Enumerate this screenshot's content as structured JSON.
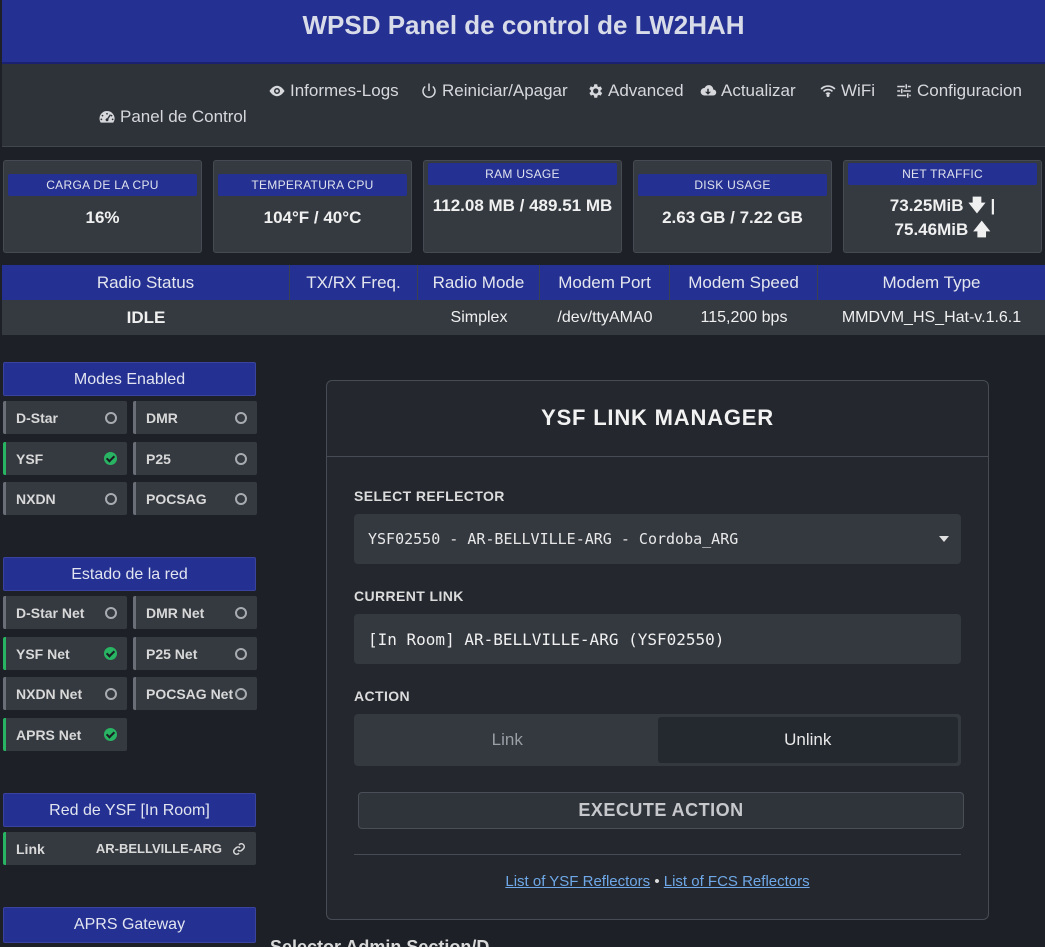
{
  "header": {
    "title": "WPSD Panel de control de LW2HAH"
  },
  "nav": {
    "items": [
      {
        "label": "Informes-Logs",
        "icon": "eye-icon"
      },
      {
        "label": "Reiniciar/Apagar",
        "icon": "power-icon"
      },
      {
        "label": "Advanced",
        "icon": "gear-icon"
      },
      {
        "label": "Actualizar",
        "icon": "cloud-download-icon"
      },
      {
        "label": "WiFi",
        "icon": "wifi-icon"
      },
      {
        "label": "Configuracion",
        "icon": "sliders-icon"
      }
    ],
    "dashboard": {
      "label": "Panel de Control",
      "icon": "gauge-icon"
    }
  },
  "stats": [
    {
      "label": "CARGA DE LA CPU",
      "value": "16%"
    },
    {
      "label": "TEMPERATURA CPU",
      "value": "104°F / 40°C"
    },
    {
      "label": "RAM USAGE",
      "value": "112.08 MB / 489.51 MB"
    },
    {
      "label": "DISK USAGE",
      "value": "2.63 GB / 7.22 GB"
    },
    {
      "label": "NET TRAFFIC",
      "value_down": "73.25MiB",
      "value_up": "75.46MiB"
    }
  ],
  "radio": {
    "headers": [
      "Radio Status",
      "TX/RX Freq.",
      "Radio Mode",
      "Modem Port",
      "Modem Speed",
      "Modem Type"
    ],
    "values": [
      "IDLE",
      "",
      "Simplex",
      "/dev/ttyAMA0",
      "115,200 bps",
      "MMDVM_HS_Hat-v.1.6.1"
    ]
  },
  "modes": {
    "title": "Modes Enabled",
    "items": [
      {
        "label": "D-Star",
        "on": false
      },
      {
        "label": "DMR",
        "on": false
      },
      {
        "label": "YSF",
        "on": true
      },
      {
        "label": "P25",
        "on": false
      },
      {
        "label": "NXDN",
        "on": false
      },
      {
        "label": "POCSAG",
        "on": false
      }
    ]
  },
  "network": {
    "title": "Estado de la red",
    "items": [
      {
        "label": "D-Star Net",
        "on": false
      },
      {
        "label": "DMR Net",
        "on": false
      },
      {
        "label": "YSF Net",
        "on": true
      },
      {
        "label": "P25 Net",
        "on": false
      },
      {
        "label": "NXDN Net",
        "on": false
      },
      {
        "label": "POCSAG Net",
        "on": false
      },
      {
        "label": "APRS Net",
        "on": true
      }
    ]
  },
  "ysf_status": {
    "title": "Red de YSF [In Room]",
    "link_label": "Link",
    "link_value": "AR-BELLVILLE-ARG"
  },
  "aprs": {
    "title": "APRS Gateway"
  },
  "manager": {
    "title": "YSF LINK MANAGER",
    "select_label": "SELECT REFLECTOR",
    "selected_reflector": "YSF02550 - AR-BELLVILLE-ARG - Cordoba_ARG",
    "current_label": "CURRENT LINK",
    "current_value": "[In Room] AR-BELLVILLE-ARG (YSF02550)",
    "action_label": "ACTION",
    "action_link": "Link",
    "action_unlink": "Unlink",
    "execute_label": "EXECUTE ACTION",
    "ysf_list_link": "List of YSF Reflectors",
    "separator": "•",
    "fcs_list_link": "List of FCS Reflectors"
  },
  "partial_heading": "Selector Admin Section/D..."
}
